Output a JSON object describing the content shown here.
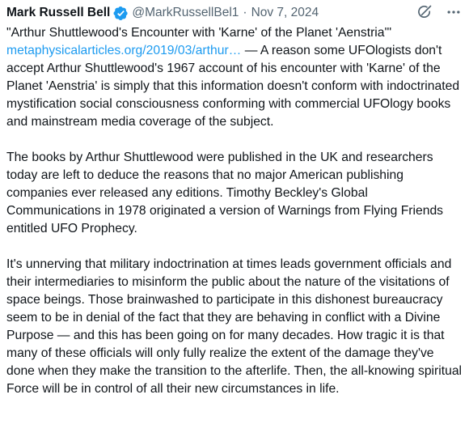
{
  "post": {
    "author_name": "Mark Russell Bell",
    "handle": "@MarkRussellBel1",
    "separator": "·",
    "date": "Nov 7, 2024",
    "verified_icon": "verified-badge-icon",
    "grok_icon": "grok-icon",
    "more_icon": "more-options-icon",
    "title": "\"Arthur Shuttlewood's Encounter with 'Karne' of the Planet 'Aenstria'\"",
    "link_text": "metaphysicalarticles.org/2019/03/arthur…",
    "paragraph1_rest": " — A reason some UFOlogists don't accept Arthur Shuttlewood's 1967 account of his encounter with 'Karne' of the Planet 'Aenstria' is simply that this information doesn't conform with indoctrinated mystification social consciousness conforming with commercial UFOlogy books and mainstream media coverage of the subject.",
    "paragraph2": "The books by Arthur Shuttlewood were published in the UK and researchers today are left to deduce the reasons that no major American publishing companies ever released any editions.  Timothy Beckley's Global Communications in 1978 originated a  version of Warnings from Flying Friends entitled UFO Prophecy.",
    "paragraph3": "It's unnerving that military indoctrination at times leads government officials and their intermediaries to misinform the public about the nature of the visitations of space beings.  Those brainwashed to participate in this dishonest bureaucracy seem to be in denial of the fact that they are behaving in conflict with a Divine Purpose — and this has been going on for many decades.  How tragic it is that many of these officials will only fully realize the extent of the damage they've done when they make the transition to the afterlife.  Then, the all-knowing spiritual Force will be in control of all their new circumstances in life."
  },
  "colors": {
    "text": "#0f1419",
    "secondary": "#536471",
    "link": "#1d9bf0",
    "verified": "#1d9bf0"
  }
}
